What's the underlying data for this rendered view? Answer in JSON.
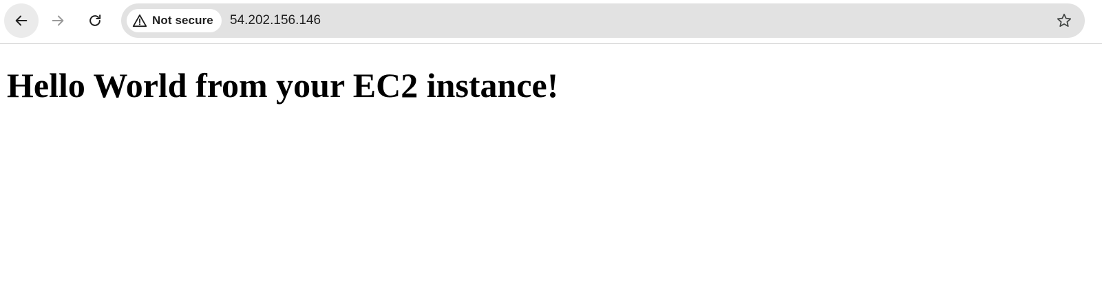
{
  "browser": {
    "security_label": "Not secure",
    "url": "54.202.156.146",
    "icons": {
      "back": "arrow-left-icon",
      "forward": "arrow-right-icon",
      "reload": "reload-icon",
      "security": "warning-triangle-icon",
      "bookmark": "star-icon"
    }
  },
  "page": {
    "heading": "Hello World from your EC2 instance!"
  },
  "colors": {
    "omnibox_bg": "#e2e2e2",
    "active_button_bg": "#ebebeb",
    "text": "#1f1f1f",
    "disabled_icon": "#9a9a9a"
  }
}
